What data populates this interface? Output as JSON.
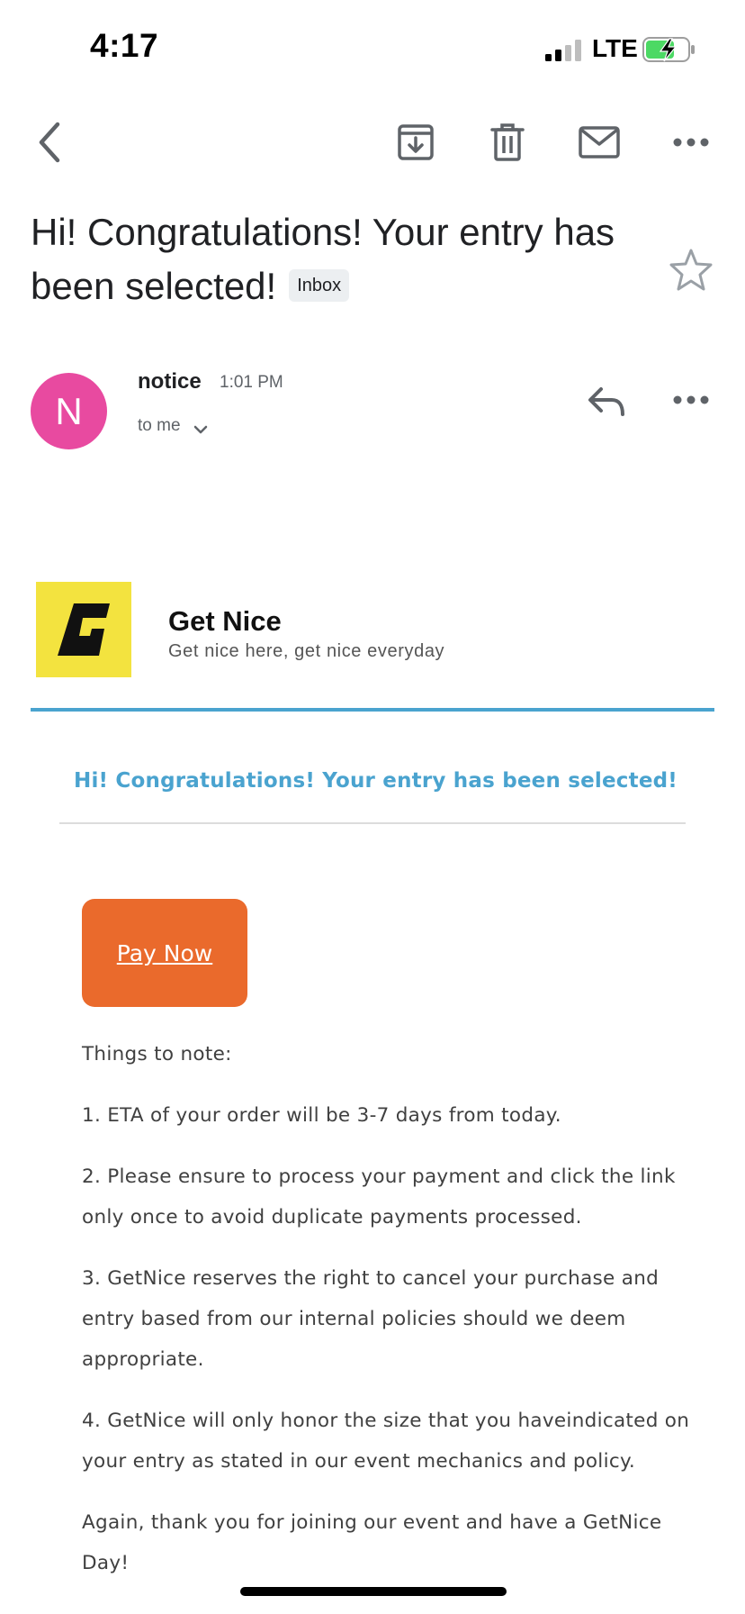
{
  "status_bar": {
    "time": "4:17",
    "network": "LTE"
  },
  "toolbar": {
    "back_icon": "chevron-left-icon",
    "archive_icon": "archive-icon",
    "delete_icon": "trash-icon",
    "mark_unread_icon": "mail-icon",
    "more_icon": "more-horizontal-icon"
  },
  "email": {
    "subject": "Hi! Congratulations! Your entry has been selected!",
    "label": "Inbox",
    "sender": {
      "initial": "N",
      "name": "notice",
      "time": "1:01 PM",
      "recipient": "to me",
      "avatar_color": "#e84aa0"
    }
  },
  "body": {
    "brand": {
      "logo_letter": "G",
      "name": "Get Nice",
      "tagline": "Get nice here, get nice everyday",
      "logo_color": "#f3e33f"
    },
    "headline": "Hi! Congratulations! Your entry has been selected!",
    "headline_color": "#4aa3cf",
    "pay_button": {
      "label": "Pay Now",
      "color": "#ea6a2c"
    },
    "notes_title": "Things to note:",
    "notes": [
      "1. ETA of your order will be 3-7 days from today.",
      "2. Please ensure to process your payment and click the link only once to avoid duplicate payments processed.",
      "3. GetNice reserves the right to cancel your purchase and entry based from our internal policies should we deem appropriate.",
      "4. GetNice will only honor the size that you haveindicated on your entry as stated in our event mechanics and policy."
    ],
    "closing": "Again, thank you for joining our event and have a GetNice Day!"
  }
}
